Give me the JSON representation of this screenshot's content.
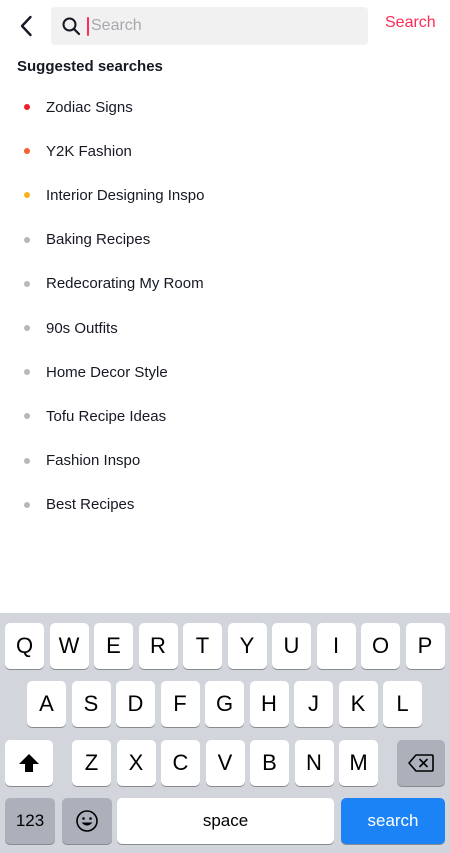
{
  "header": {
    "back_icon": "chevron-left-icon",
    "search_icon": "magnifier-icon",
    "search_placeholder": "Search",
    "search_action": "Search",
    "accent_color": "#fe2c55"
  },
  "suggestions": {
    "title": "Suggested searches",
    "items": [
      {
        "label": "Zodiac Signs",
        "dot_color": "#ee1d2d"
      },
      {
        "label": "Y2K Fashion",
        "dot_color": "#f5602b"
      },
      {
        "label": "Interior Designing Inspo",
        "dot_color": "#f7b21d"
      },
      {
        "label": "Baking Recipes",
        "dot_color": "#b7b8bb"
      },
      {
        "label": "Redecorating My Room",
        "dot_color": "#b7b8bb"
      },
      {
        "label": "90s Outfits",
        "dot_color": "#b7b8bb"
      },
      {
        "label": "Home Decor Style",
        "dot_color": "#b7b8bb"
      },
      {
        "label": "Tofu Recipe Ideas",
        "dot_color": "#b7b8bb"
      },
      {
        "label": "Fashion Inspo",
        "dot_color": "#b7b8bb"
      },
      {
        "label": "Best Recipes",
        "dot_color": "#b7b8bb"
      }
    ]
  },
  "keyboard": {
    "row1": [
      "Q",
      "W",
      "E",
      "R",
      "T",
      "Y",
      "U",
      "I",
      "O",
      "P"
    ],
    "row2": [
      "A",
      "S",
      "D",
      "F",
      "G",
      "H",
      "J",
      "K",
      "L"
    ],
    "row3": [
      "Z",
      "X",
      "C",
      "V",
      "B",
      "N",
      "M"
    ],
    "shift_icon": "shift-arrow-icon",
    "delete_icon": "backspace-icon",
    "numbers_label": "123",
    "emoji_icon": "emoji-smiley-icon",
    "space_label": "space",
    "search_label": "search",
    "action_color": "#1b83f5"
  }
}
